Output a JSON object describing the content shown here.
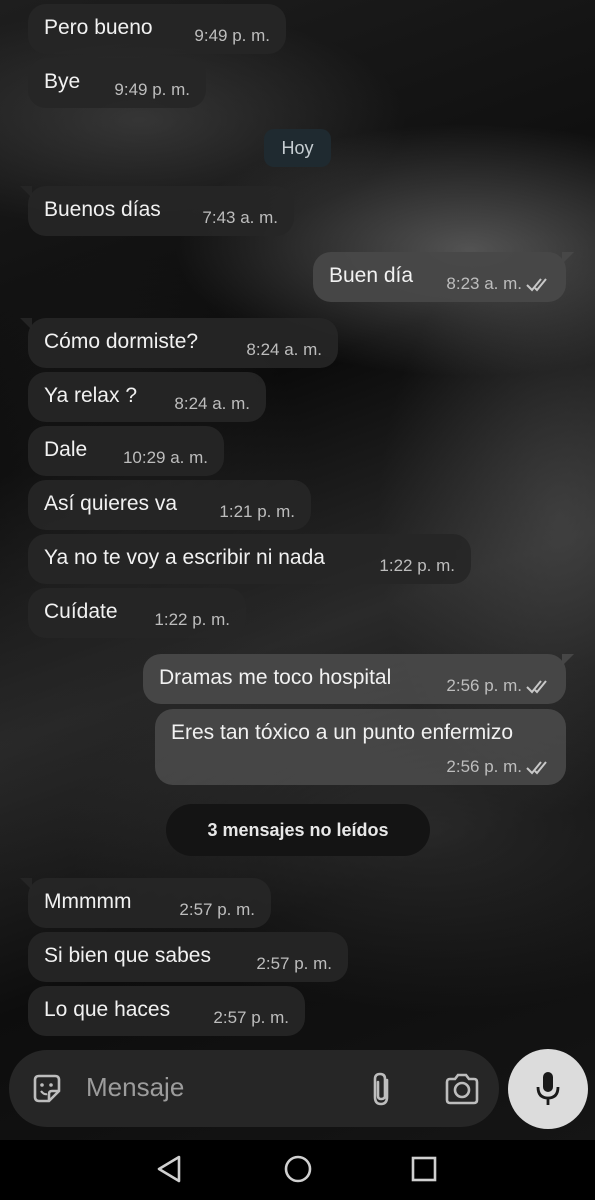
{
  "date_divider": "Hoy",
  "unread_banner": "3 mensajes no leídos",
  "messages": [
    {
      "text": "Pero bueno",
      "time": "9:49 p. m."
    },
    {
      "text": "Bye",
      "time": "9:49 p. m."
    },
    {
      "text": "Buenos días",
      "time": "7:43 a. m."
    },
    {
      "text": "Buen día",
      "time": "8:23 a. m."
    },
    {
      "text": "Cómo dormiste?",
      "time": "8:24 a. m."
    },
    {
      "text": "Ya relax ?",
      "time": "8:24 a. m."
    },
    {
      "text": "Dale",
      "time": "10:29 a. m."
    },
    {
      "text": "Así quieres va",
      "time": "1:21 p. m."
    },
    {
      "text": "Ya no te voy a escribir ni nada",
      "time": "1:22 p. m."
    },
    {
      "text": "Cuídate",
      "time": "1:22 p. m."
    },
    {
      "text": "Dramas me toco hospital",
      "time": "2:56 p. m."
    },
    {
      "text": "Eres tan tóxico a un punto enfermizo",
      "time": "2:56 p. m."
    },
    {
      "text": "Mmmmm",
      "time": "2:57 p. m."
    },
    {
      "text": "Si bien que sabes",
      "time": "2:57 p. m."
    },
    {
      "text": "Lo que haces",
      "time": "2:57 p. m."
    }
  ],
  "composer": {
    "placeholder": "Mensaje",
    "icons": [
      "sticker-icon",
      "attach-icon",
      "camera-icon",
      "mic-icon"
    ]
  },
  "nav": {
    "icons": [
      "back-icon",
      "home-icon",
      "recents-icon"
    ]
  },
  "colors": {
    "read_ticks": "#c8c8c8",
    "incoming_bubble": "#262626",
    "outgoing_bubble": "#484848"
  }
}
